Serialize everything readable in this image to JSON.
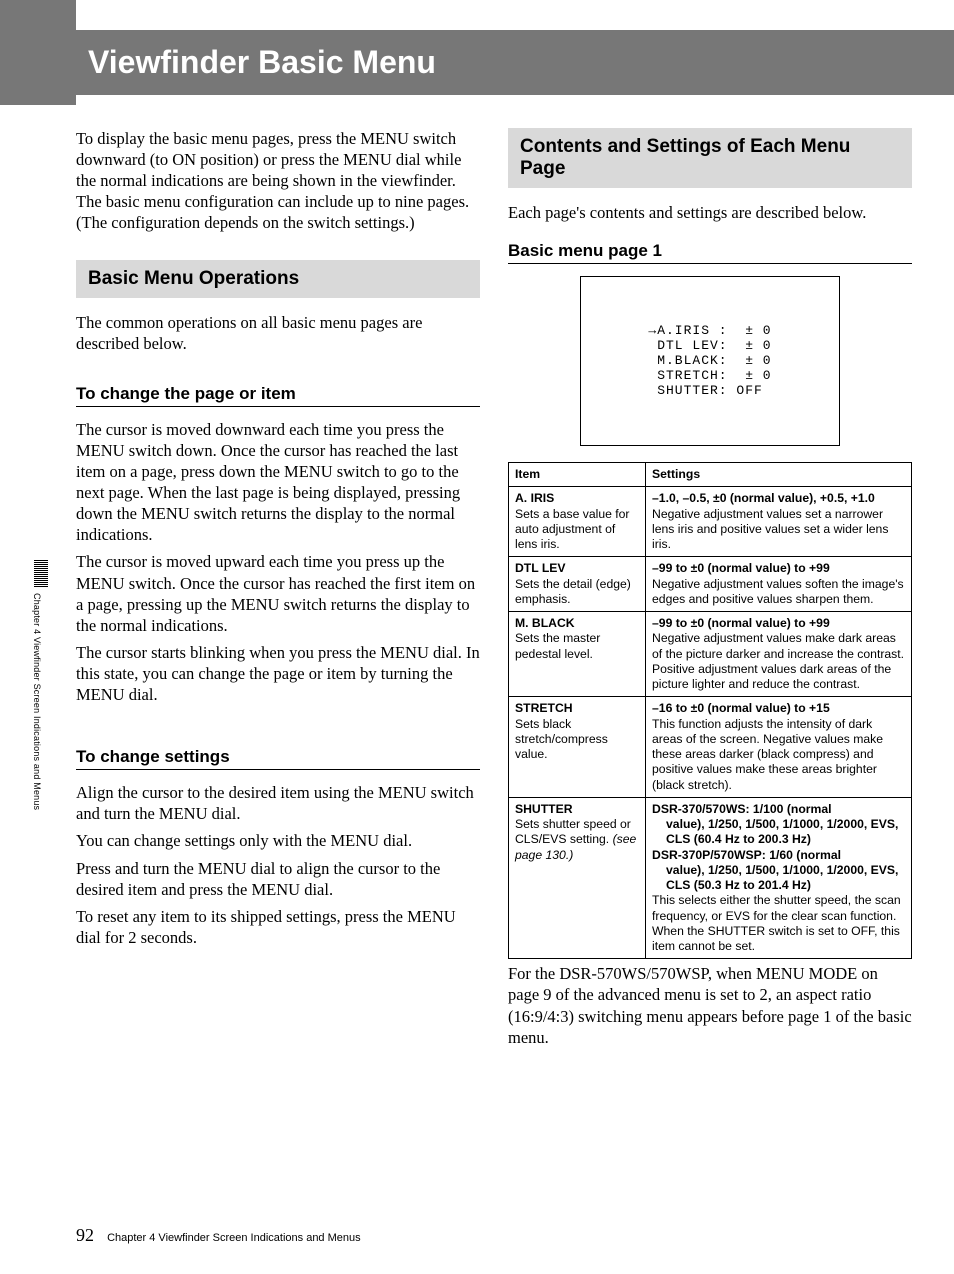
{
  "title": "Viewfinder Basic Menu",
  "side_label": "Chapter 4 Viewfinder Screen Indications and Menus",
  "left": {
    "intro": "To display the basic menu pages, press the MENU switch downward (to ON position) or press the MENU dial while the normal indications are being shown in the viewfinder.  The basic menu configuration can include up to nine pages. (The configuration depends on the switch settings.)",
    "section1": "Basic Menu Operations",
    "p1": "The common operations on all basic menu pages are described below.",
    "sub1": "To change the page or item",
    "p2": "The cursor is moved downward each time you press the MENU switch down.  Once the cursor has reached the last item on a page, press down the MENU switch to go to the next page.  When the last page is being displayed, pressing down the MENU switch returns the display to the normal indications.",
    "p3": "The cursor is moved upward each time you press up the MENU switch.  Once the cursor has reached the first item on a page, pressing up the MENU switch returns the display to the normal indications.",
    "p4": "The cursor starts blinking when you press the MENU dial.  In this state, you can change the page or item by turning the MENU dial.",
    "sub2": "To change settings",
    "p5": "Align the cursor to the desired item using the MENU switch and turn the MENU dial.",
    "p6": "You can change settings only with the MENU dial.",
    "p7": "Press and turn the MENU dial to align the cursor to the desired item and press the MENU dial.",
    "p8": "To reset any item to its shipped settings, press the MENU dial for 2 seconds."
  },
  "right": {
    "section": "Contents and Settings of Each Menu Page",
    "p1": "Each page's contents and settings are described below.",
    "sub1": "Basic menu page 1",
    "vf_text": "→A.IRIS :  ± 0\n DTL LEV:  ± 0\n M.BLACK:  ± 0\n STRETCH:  ± 0\n SHUTTER: OFF",
    "table": {
      "headers": [
        "Item",
        "Settings"
      ],
      "rows": [
        {
          "item_title": "A. IRIS",
          "item_desc": "Sets a base value for auto adjustment of lens iris.",
          "set_bold": "–1.0, –0.5, ±0 (normal value), +0.5, +1.0",
          "set_desc": "Negative adjustment values set a narrower lens iris and positive values set a wider lens iris."
        },
        {
          "item_title": "DTL LEV",
          "item_desc": "Sets the detail (edge) emphasis.",
          "set_bold": "–99 to ±0 (normal value) to +99",
          "set_desc": "Negative adjustment values soften the image's edges and positive values sharpen them."
        },
        {
          "item_title": "M. BLACK",
          "item_desc": "Sets the master pedestal level.",
          "set_bold": "–99 to ±0 (normal value) to +99",
          "set_desc": "Negative adjustment values make dark areas of the picture darker and increase the contrast.  Positive adjustment values dark areas of the picture lighter and reduce the contrast."
        },
        {
          "item_title": "STRETCH",
          "item_desc": "Sets black stretch/compress value.",
          "set_bold": "–16 to ±0 (normal value) to +15",
          "set_desc": "This function adjusts the intensity of dark areas of the screen.  Negative values make these areas darker (black compress) and positive values make these areas brighter (black stretch)."
        },
        {
          "item_title": "SHUTTER",
          "item_desc_a": "Sets shutter speed or CLS/EVS setting. ",
          "item_desc_b": "(see page 130.)",
          "set_block1a": "DSR-370/570WS:  1/100 (normal",
          "set_block1b": "value), 1/250, 1/500, 1/1000, 1/2000, EVS, CLS (60.4 Hz to 200.3 Hz)",
          "set_block2a": "DSR-370P/570WSP:  1/60 (normal",
          "set_block2b": "value), 1/250, 1/500, 1/1000, 1/2000, EVS, CLS (50.3 Hz to 201.4 Hz)",
          "set_desc": "This selects either the shutter speed, the scan frequency, or EVS for the clear scan function. When the SHUTTER switch is set to OFF, this item cannot be set."
        }
      ]
    },
    "after_table": "For the DSR-570WS/570WSP, when MENU MODE on page 9 of the advanced menu is set to 2, an aspect ratio (16:9/4:3) switching menu appears before page 1 of the basic menu."
  },
  "footer": {
    "page_num": "92",
    "chapter": "Chapter 4   Viewfinder Screen Indications and Menus"
  }
}
